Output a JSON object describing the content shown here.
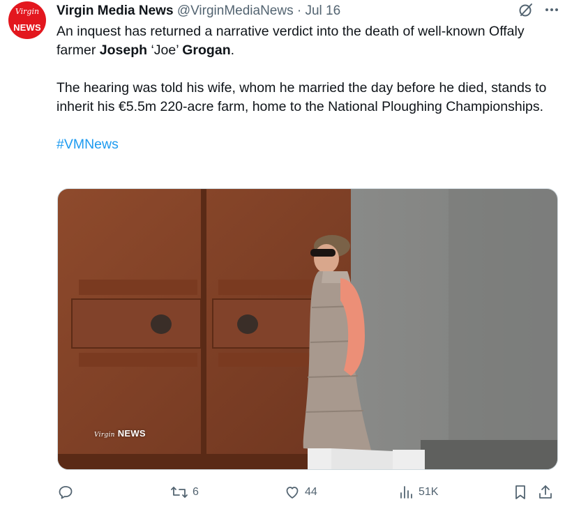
{
  "account": {
    "display_name": "Virgin Media News",
    "handle": "@VirginMediaNews",
    "separator": "·",
    "date": "Jul 16",
    "avatar_script": "Virgin",
    "avatar_label": "NEWS",
    "avatar_color": "#e3171e"
  },
  "tweet": {
    "line1_pre": "An inquest has returned a narrative verdict into the death of well-known Offaly farmer ",
    "name_first": "Joseph",
    "name_nick": " ‘Joe’ ",
    "name_last": "Grogan",
    "line1_post": ".",
    "paragraph2": "The hearing was told his wife, whom he married the day before he died, stands to inherit his €5.5m 220-acre farm, home to the National Ploughing Championships.",
    "hashtag": "#VMNews"
  },
  "media": {
    "watermark": "NEWS",
    "watermark_script": "Virgin"
  },
  "actions": {
    "reply_count": "",
    "retweet_count": "6",
    "like_count": "44",
    "view_count": "51K"
  },
  "icons": [
    "grok-icon",
    "more-icon",
    "reply-icon",
    "retweet-icon",
    "like-icon",
    "views-icon",
    "bookmark-icon",
    "share-icon"
  ],
  "colors": {
    "link": "#1d9bf0",
    "secondary_text": "#536471",
    "brand_red": "#e3171e"
  }
}
